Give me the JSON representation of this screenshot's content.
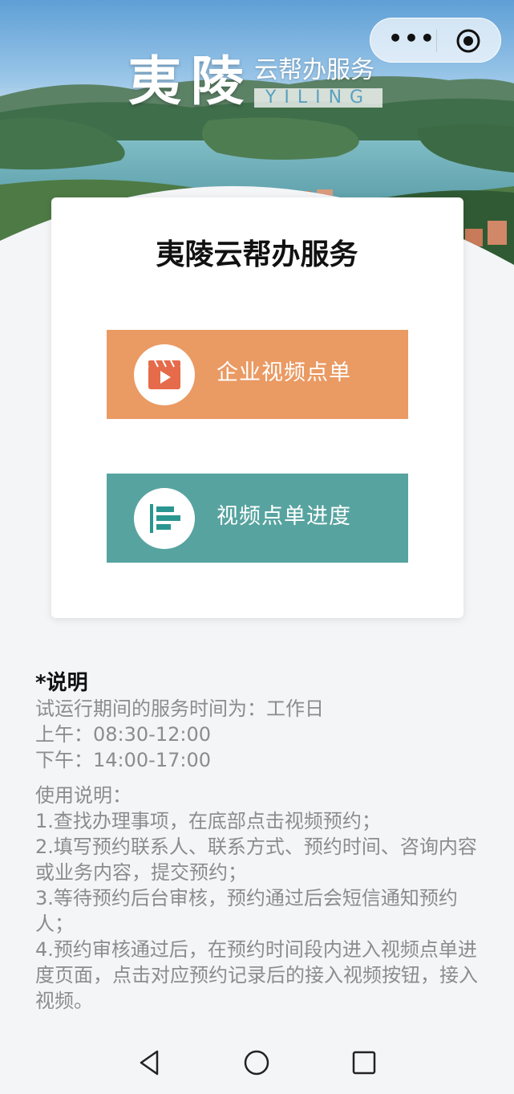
{
  "banner": {
    "title_big": "夷陵",
    "title_sub": "云帮办服务",
    "title_en": "YILING"
  },
  "capsule": {
    "more_icon": "more-icon",
    "close_icon": "target-icon"
  },
  "card": {
    "title": "夷陵云帮办服务",
    "buttons": [
      {
        "label": "企业视频点单",
        "icon": "video-play-icon",
        "color": "#ea9a63"
      },
      {
        "label": "视频点单进度",
        "icon": "progress-bars-icon",
        "color": "#57a39f"
      }
    ]
  },
  "notes": {
    "heading": "*说明",
    "service_time": "试运行期间的服务时间为：工作日",
    "morning": "上午：08:30-12:00",
    "afternoon": "下午：14:00-17:00",
    "usage_title": "使用说明：",
    "step1": "1.查找办理事项，在底部点击视频预约；",
    "step2": "2.填写预约联系人、联系方式、预约时间、咨询内容或业务内容，提交预约；",
    "step3": "3.等待预约后台审核，预约通过后会短信通知预约人；",
    "step4": "4.预约审核通过后，在预约时间段内进入视频点单进度页面，点击对应预约记录后的接入视频按钮，接入视频。"
  },
  "navbar": {
    "back": "back-triangle-icon",
    "home": "home-circle-icon",
    "recents": "recents-square-icon"
  }
}
